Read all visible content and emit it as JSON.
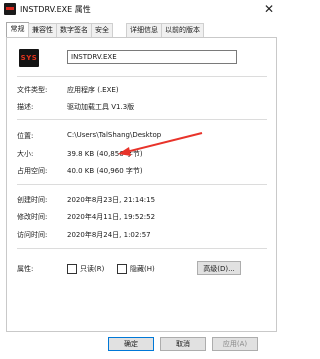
{
  "window": {
    "title": "INSTDRV.EXE 属性",
    "close_glyph": "✕",
    "app_icon": "app-icon"
  },
  "tabs": [
    {
      "label": "常规",
      "active": true
    },
    {
      "label": "兼容性",
      "active": false
    },
    {
      "label": "数字签名",
      "active": false
    },
    {
      "label": "安全",
      "active": false
    },
    {
      "label": "详细信息",
      "active": false
    },
    {
      "label": "以前的版本",
      "active": false
    }
  ],
  "general": {
    "file_icon_text": "SYS",
    "file_name": "INSTDRV.EXE",
    "file_type_label": "文件类型:",
    "file_type_value": "应用程序 (.EXE)",
    "description_label": "描述:",
    "description_value": "驱动加载工具 V1.3版",
    "location_label": "位置:",
    "location_value": "C:\\Users\\TalShang\\Desktop",
    "size_label": "大小:",
    "size_value": "39.8 KB (40,856 字节)",
    "size_on_disk_label": "占用空间:",
    "size_on_disk_value": "40.0 KB (40,960 字节)",
    "created_label": "创建时间:",
    "created_value": "2020年8月23日, 21:14:15",
    "modified_label": "修改时间:",
    "modified_value": "2020年4月11日, 19:52:52",
    "accessed_label": "访问时间:",
    "accessed_value": "2020年8月24日, 1:02:57",
    "attributes_label": "属性:",
    "readonly_label": "只读(R)",
    "hidden_label": "隐藏(H)",
    "advanced_label": "高级(D)..."
  },
  "footer": {
    "ok_label": "确定",
    "cancel_label": "取消",
    "apply_label": "应用(A)"
  },
  "colors": {
    "annotation_arrow": "#e8332a",
    "accent": "#0078d7"
  }
}
